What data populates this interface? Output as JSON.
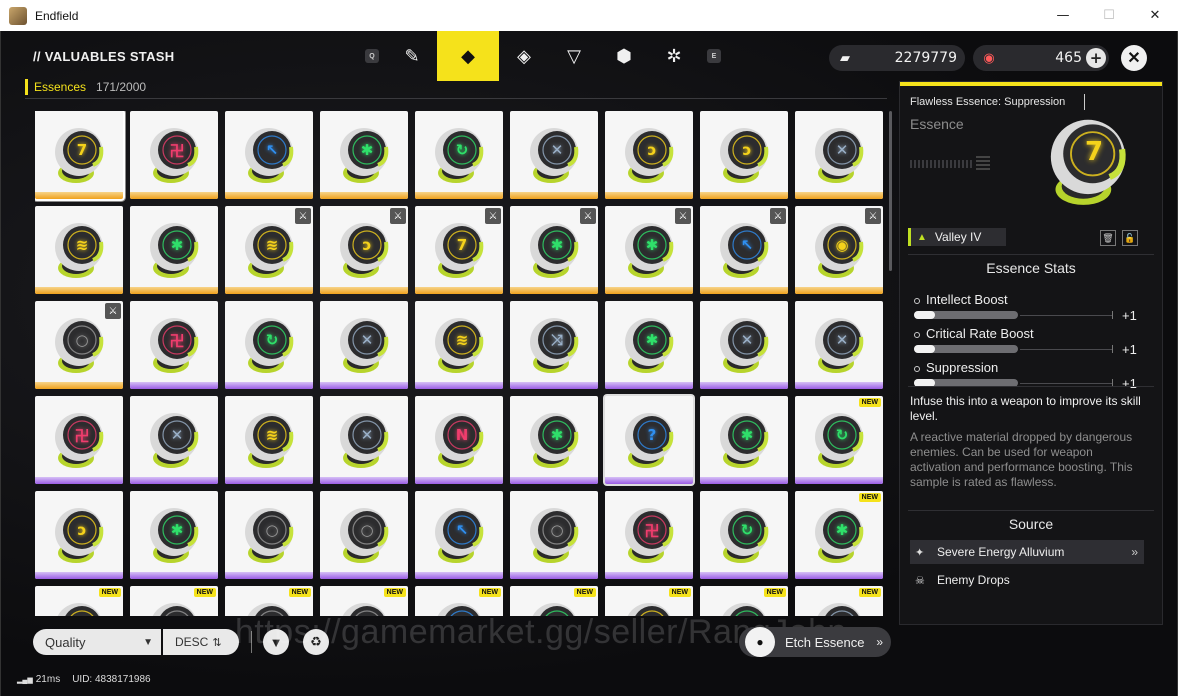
{
  "window": {
    "title": "Endfield",
    "min_label": "—",
    "max_label": "☐",
    "close_label": "✕"
  },
  "header": {
    "stash_title": "// VALUABLES STASH",
    "tabs": [
      {
        "key": "Q"
      },
      {
        "icon": "weapon-icon",
        "glyph": "✎"
      },
      {
        "icon": "cube-icon",
        "glyph": "◆",
        "active": true
      },
      {
        "icon": "diamond-icon",
        "glyph": "◈"
      },
      {
        "icon": "triangle-icon",
        "glyph": "▽"
      },
      {
        "icon": "box-icon",
        "glyph": "⬢"
      },
      {
        "icon": "gear-icon",
        "glyph": "✲"
      },
      {
        "key": "E"
      }
    ],
    "currency1": {
      "icon": "ticket-icon",
      "glyph": "▰",
      "value": "2279779"
    },
    "currency2": {
      "icon": "crystal-icon",
      "glyph": "◉",
      "value": "465"
    },
    "plus_label": "+",
    "close_label": "✕"
  },
  "filter": {
    "category": "Essences",
    "count": "171/2000"
  },
  "grid": {
    "items": [
      {
        "c": "#f5d21b",
        "s": "7",
        "r": "gold",
        "sel": true
      },
      {
        "c": "#ef3d6d",
        "s": "卍",
        "r": "gold"
      },
      {
        "c": "#2f8ff0",
        "s": "↖",
        "r": "gold"
      },
      {
        "c": "#2fe06a",
        "s": "✱",
        "r": "gold"
      },
      {
        "c": "#2fe06a",
        "s": "↻",
        "r": "gold"
      },
      {
        "c": "#9ab0c8",
        "s": "✕",
        "r": "gold"
      },
      {
        "c": "#f5d21b",
        "s": "ↄ",
        "r": "gold"
      },
      {
        "c": "#f5d21b",
        "s": "ↄ",
        "r": "gold"
      },
      {
        "c": "#9ab0c8",
        "s": "✕",
        "r": "gold"
      },
      {
        "c": "#f5d21b",
        "s": "≋",
        "r": "gold"
      },
      {
        "c": "#2fe06a",
        "s": "✱",
        "r": "gold"
      },
      {
        "c": "#f5d21b",
        "s": "≋",
        "r": "gold",
        "lock": true
      },
      {
        "c": "#f5d21b",
        "s": "ↄ",
        "r": "gold",
        "lock": true
      },
      {
        "c": "#f5d21b",
        "s": "7",
        "r": "gold",
        "lock": true
      },
      {
        "c": "#2fe06a",
        "s": "✱",
        "r": "gold",
        "lock": true
      },
      {
        "c": "#2fe06a",
        "s": "✱",
        "r": "gold",
        "lock": true
      },
      {
        "c": "#2f8ff0",
        "s": "↖",
        "r": "gold",
        "lock": true
      },
      {
        "c": "#f5d21b",
        "s": "◉",
        "r": "gold",
        "lock": true
      },
      {
        "c": "#9a9a9a",
        "s": "○",
        "r": "gold",
        "lock": true
      },
      {
        "c": "#ef3d6d",
        "s": "卍",
        "r": "purple"
      },
      {
        "c": "#2fe06a",
        "s": "↻",
        "r": "purple"
      },
      {
        "c": "#9ab0c8",
        "s": "✕",
        "r": "purple"
      },
      {
        "c": "#f5d21b",
        "s": "≋",
        "r": "purple"
      },
      {
        "c": "#9ab0c8",
        "s": "⤨",
        "r": "purple"
      },
      {
        "c": "#2fe06a",
        "s": "✱",
        "r": "purple"
      },
      {
        "c": "#9ab0c8",
        "s": "✕",
        "r": "purple"
      },
      {
        "c": "#9ab0c8",
        "s": "✕",
        "r": "purple"
      },
      {
        "c": "#ef3d6d",
        "s": "卍",
        "r": "purple"
      },
      {
        "c": "#9ab0c8",
        "s": "✕",
        "r": "purple"
      },
      {
        "c": "#f5d21b",
        "s": "≋",
        "r": "purple"
      },
      {
        "c": "#9ab0c8",
        "s": "✕",
        "r": "purple"
      },
      {
        "c": "#ef3d6d",
        "s": "N",
        "r": "purple"
      },
      {
        "c": "#2fe06a",
        "s": "✱",
        "r": "purple"
      },
      {
        "c": "#2f8ff0",
        "s": "?",
        "r": "purple",
        "bordered": true
      },
      {
        "c": "#2fe06a",
        "s": "✱",
        "r": "purple"
      },
      {
        "c": "#2fe06a",
        "s": "↻",
        "r": "purple",
        "new": true
      },
      {
        "c": "#f5d21b",
        "s": "ↄ",
        "r": "purple"
      },
      {
        "c": "#2fe06a",
        "s": "✱",
        "r": "purple"
      },
      {
        "c": "#9a9a9a",
        "s": "○",
        "r": "purple"
      },
      {
        "c": "#9a9a9a",
        "s": "○",
        "r": "purple"
      },
      {
        "c": "#2f8ff0",
        "s": "↖",
        "r": "purple"
      },
      {
        "c": "#9a9a9a",
        "s": "○",
        "r": "purple"
      },
      {
        "c": "#ef3d6d",
        "s": "卍",
        "r": "purple"
      },
      {
        "c": "#2fe06a",
        "s": "↻",
        "r": "purple"
      },
      {
        "c": "#2fe06a",
        "s": "✱",
        "r": "purple",
        "new": true
      },
      {
        "c": "#f5d21b",
        "s": "",
        "r": "purple",
        "new": true
      },
      {
        "c": "#9a9a9a",
        "s": "",
        "r": "purple",
        "new": true
      },
      {
        "c": "#9a9a9a",
        "s": "",
        "r": "purple",
        "new": true
      },
      {
        "c": "#9a9a9a",
        "s": "",
        "r": "purple",
        "new": true
      },
      {
        "c": "#2f8ff0",
        "s": "",
        "r": "purple",
        "new": true
      },
      {
        "c": "#2fe06a",
        "s": "",
        "r": "purple",
        "new": true
      },
      {
        "c": "#f5d21b",
        "s": "",
        "r": "purple",
        "new": true
      },
      {
        "c": "#2fe06a",
        "s": "",
        "r": "purple",
        "new": true
      },
      {
        "c": "#9ab0c8",
        "s": "",
        "r": "purple",
        "new": true
      }
    ],
    "new_label": "NEW",
    "lock_glyph": "⚔"
  },
  "bottom": {
    "sort_label": "Quality",
    "sort_chevron": "▼",
    "order_label": "DESC",
    "order_icon": "⇅",
    "filter_glyph": "▼",
    "recycle_glyph": "♻",
    "etch_label": "Etch Essence",
    "etch_glyph": "●",
    "etch_chevron": "»",
    "watermark": "https://gamemarket.gg/seller/RangJohn",
    "ping": "21ms",
    "uid": "UID: 4838171986"
  },
  "detail": {
    "name": "Flawless Essence: Suppression",
    "type": "Essence",
    "tag_label": "Valley IV",
    "tag_glyph": "▲",
    "trash_glyph": "🗑",
    "lock_glyph": "🔓",
    "stats_title": "Essence Stats",
    "stats": [
      {
        "name": "Intellect Boost",
        "bonus": "+1",
        "level": 0.2
      },
      {
        "name": "Critical Rate Boost",
        "bonus": "+1",
        "level": 0.2
      },
      {
        "name": "Suppression",
        "bonus": "+1",
        "level": 0.2
      }
    ],
    "description": "Infuse this into a weapon to improve its skill level.",
    "lore": "A reactive material dropped by dangerous enemies. Can be used for weapon activation and performance boosting. This sample is rated as flawless.",
    "source_title": "Source",
    "sources": [
      {
        "label": "Severe Energy Alluvium",
        "glyph": "✦",
        "chevron": "»"
      },
      {
        "label": "Enemy Drops",
        "glyph": "☠",
        "chevron": ""
      }
    ],
    "orb_color": "#f5d21b",
    "orb_symbol": "7"
  }
}
